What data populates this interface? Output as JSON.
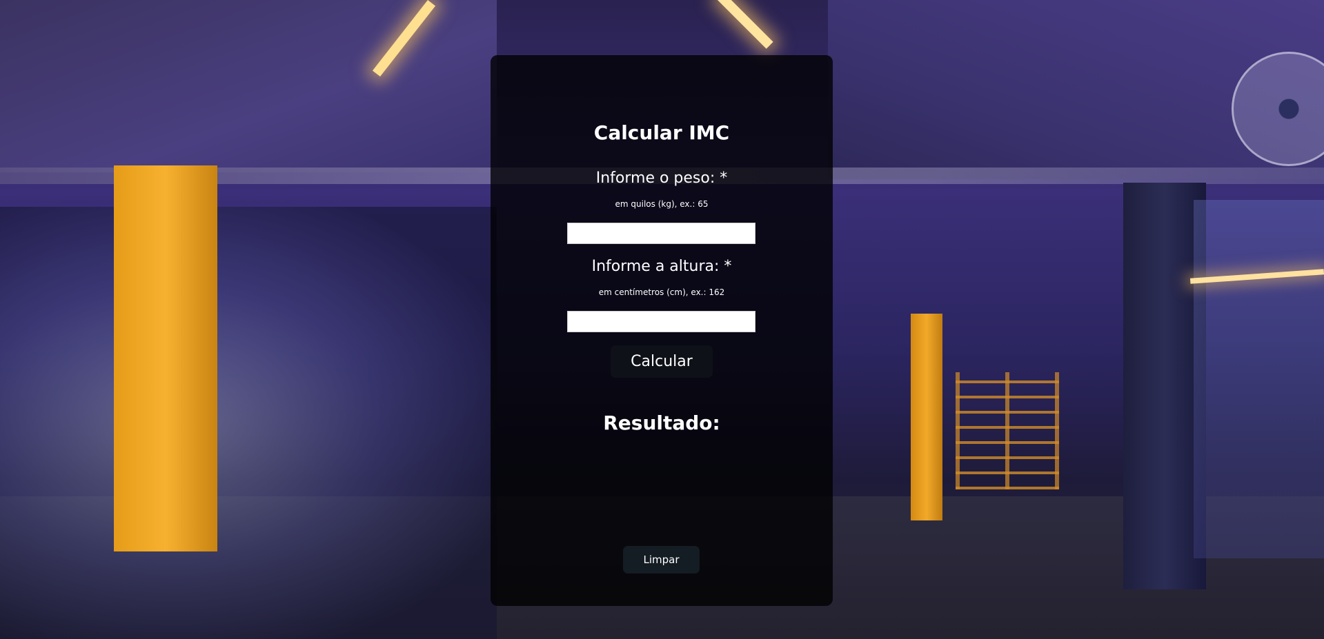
{
  "form": {
    "title": "Calcular IMC",
    "weight": {
      "label": "Informe o peso: *",
      "hint": "em quilos (kg), ex.: 65",
      "value": ""
    },
    "height": {
      "label": "Informe a altura: *",
      "hint": "em centímetros (cm), ex.: 162",
      "value": ""
    },
    "calculate_label": "Calcular",
    "result_title": "Resultado:",
    "result_value": "",
    "clear_label": "Limpar"
  },
  "colors": {
    "card_background": "#000000",
    "calculate_button": "#0e1118",
    "clear_button": "#141c24",
    "text": "#ffffff"
  }
}
